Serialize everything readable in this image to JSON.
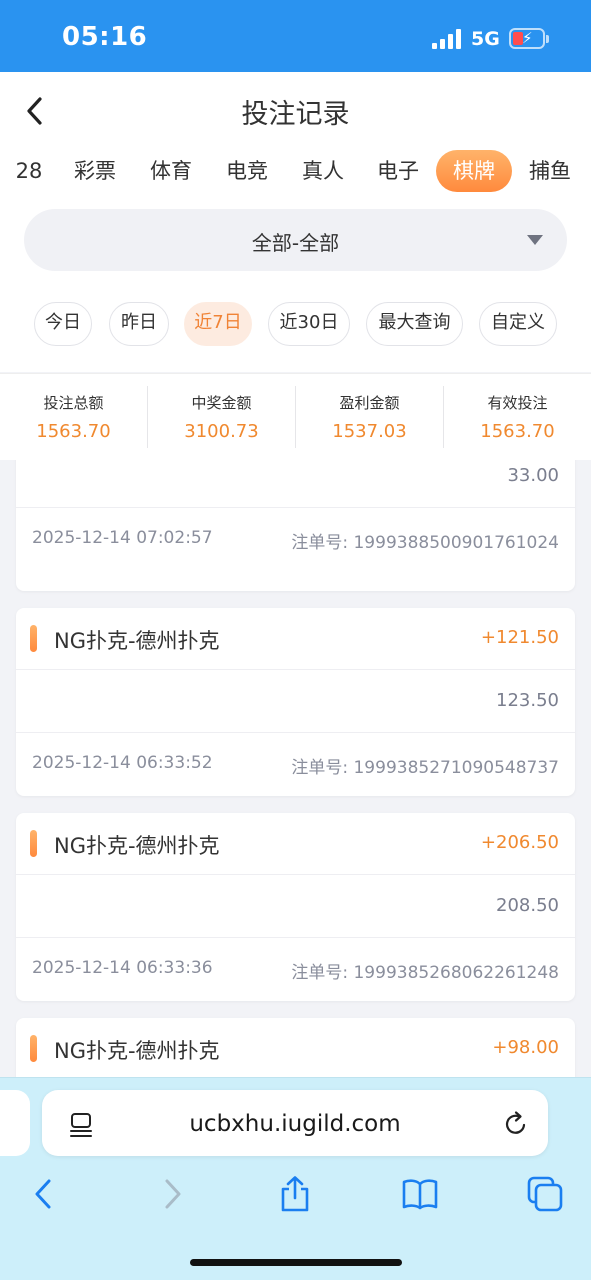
{
  "status_bar": {
    "time": "05:16",
    "network": "5G"
  },
  "header": {
    "title": "投注记录"
  },
  "tabs": [
    {
      "label": "28"
    },
    {
      "label": "彩票"
    },
    {
      "label": "体育"
    },
    {
      "label": "电竞"
    },
    {
      "label": "真人"
    },
    {
      "label": "电子"
    },
    {
      "label": "棋牌",
      "active": true
    },
    {
      "label": "捕鱼"
    }
  ],
  "filter": {
    "value": "全部-全部"
  },
  "date_ranges": [
    {
      "label": "今日"
    },
    {
      "label": "昨日"
    },
    {
      "label": "近7日",
      "active": true
    },
    {
      "label": "近30日"
    },
    {
      "label": "最大查询"
    },
    {
      "label": "自定义"
    }
  ],
  "summary": [
    {
      "label": "投注总额",
      "value": "1563.70"
    },
    {
      "label": "中奖金额",
      "value": "3100.73"
    },
    {
      "label": "盈利金额",
      "value": "1537.03"
    },
    {
      "label": "有效投注",
      "value": "1563.70"
    }
  ],
  "records": [
    {
      "amount": "33.00",
      "time": "2025-12-14 07:02:57",
      "order": "注单号: 1999388500901761024"
    },
    {
      "game": "NG扑克-德州扑克",
      "profit": "+121.50",
      "amount": "123.50",
      "time": "2025-12-14 06:33:52",
      "order": "注单号: 1999385271090548737"
    },
    {
      "game": "NG扑克-德州扑克",
      "profit": "+206.50",
      "amount": "208.50",
      "time": "2025-12-14 06:33:36",
      "order": "注单号: 1999385268062261248"
    },
    {
      "game": "NG扑克-德州扑克",
      "profit": "+98.00"
    }
  ],
  "browser": {
    "url": "ucbxhu.iugild.com"
  },
  "colors": {
    "status_bar": "#2a93f0",
    "accent": "#f0892f",
    "active_tab": "#ff8a3d",
    "browser_bg": "#cdeffa"
  }
}
